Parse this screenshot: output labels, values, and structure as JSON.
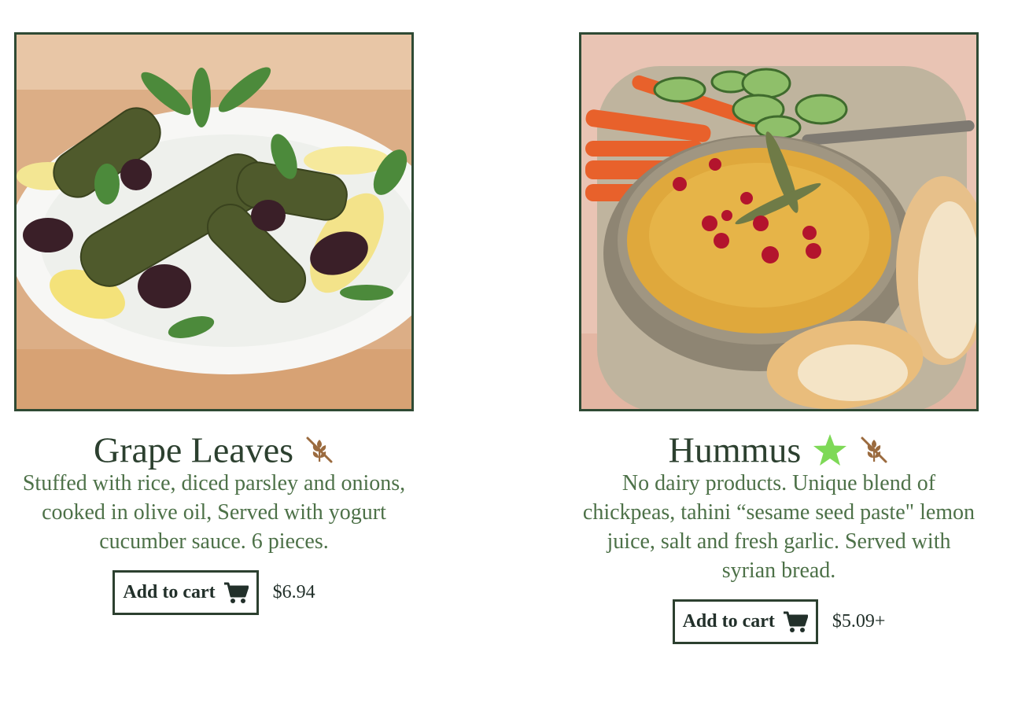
{
  "products": [
    {
      "name": "Grape Leaves",
      "badges": [
        "gluten-free-icon"
      ],
      "description": "Stuffed with rice, diced parsley and onions, cooked in olive oil, Served with yogurt cucumber sauce. 6 pieces.",
      "add_to_cart_label": "Add to cart",
      "price": "$6.94"
    },
    {
      "name": "Hummus",
      "badges": [
        "star-icon",
        "gluten-free-icon"
      ],
      "description": "No dairy products. Unique blend of chickpeas, tahini “sesame seed paste\" lemon juice, salt and fresh garlic. Served with syrian bread.",
      "add_to_cart_label": "Add to cart",
      "price": "$5.09+"
    }
  ],
  "colors": {
    "frame_border": "#2f4a34",
    "title_text": "#2c402f",
    "description_text": "#4d7148",
    "star": "#7ed957",
    "gluten_free_icon": "#9b6b3f"
  }
}
